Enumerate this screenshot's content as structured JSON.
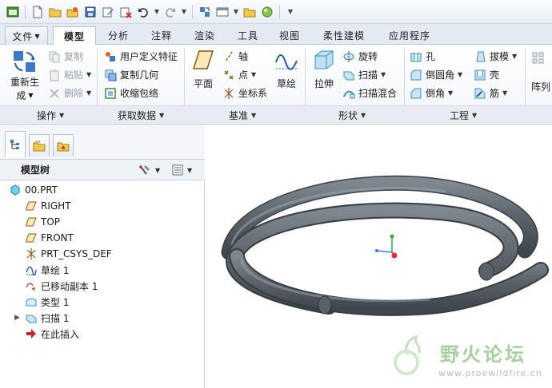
{
  "quick_access": {
    "icons": [
      "window-icon",
      "new-file-icon",
      "open-folder-icon",
      "open-session-icon",
      "save-icon",
      "edit-icon",
      "close-window-icon",
      "undo-icon",
      "redo-icon",
      "regenerate-icon",
      "window-switch-icon",
      "folder-icon",
      "appearance-icon",
      "more-icon"
    ]
  },
  "tabs": [
    {
      "label": "文件",
      "has_dropdown": true
    },
    {
      "label": "模型",
      "active": true
    },
    {
      "label": "分析"
    },
    {
      "label": "注释"
    },
    {
      "label": "渲染"
    },
    {
      "label": "工具"
    },
    {
      "label": "视图"
    },
    {
      "label": "柔性建模"
    },
    {
      "label": "应用程序"
    }
  ],
  "ribbon": {
    "operations": {
      "group_label": "操作",
      "regenerate_line1": "重新生",
      "regenerate_line2": "成",
      "copy": "复制",
      "paste": "粘贴",
      "delete": "删除"
    },
    "get_data": {
      "group_label": "获取数据",
      "user_defined_feature": "用户定义特征",
      "copy_geometry": "复制几何",
      "shrinkwrap": "收缩包络"
    },
    "datum": {
      "group_label": "基准",
      "plane": "平面",
      "axis": "轴",
      "point": "点",
      "csys": "坐标系",
      "sketch": "草绘"
    },
    "shapes": {
      "group_label": "形状",
      "extrude": "拉伸",
      "revolve": "旋转",
      "sweep": "扫描",
      "swept_blend": "扫描混合"
    },
    "engineering": {
      "group_label": "工程",
      "hole": "孔",
      "round": "倒圆角",
      "chamfer": "倒角",
      "draft": "拔模",
      "shell": "壳",
      "rib": "筋"
    },
    "editing": {
      "pattern": "阵列"
    }
  },
  "model_tree": {
    "title": "模型树",
    "items": [
      {
        "label": "00.PRT",
        "icon": "part-icon"
      },
      {
        "label": "RIGHT",
        "icon": "datum-plane-icon"
      },
      {
        "label": "TOP",
        "icon": "datum-plane-icon"
      },
      {
        "label": "FRONT",
        "icon": "datum-plane-icon"
      },
      {
        "label": "PRT_CSYS_DEF",
        "icon": "csys-icon"
      },
      {
        "label": "草绘 1",
        "icon": "sketch-icon"
      },
      {
        "label": "已移动副本 1",
        "icon": "moved-copy-icon"
      },
      {
        "label": "类型 1",
        "icon": "quilt-icon"
      },
      {
        "label": "扫描 1",
        "icon": "sweep-icon",
        "expandable": true
      },
      {
        "label": "在此插入",
        "icon": "insert-here-arrow-icon"
      }
    ]
  },
  "watermark": {
    "title": "野火论坛",
    "url": "www.proewildfire.cn"
  },
  "colors": {
    "ribbon_bg": "#f2f5f9",
    "tab_bar_bg": "#e4eaf2",
    "model_gray": "#5f6870",
    "watermark_green": "#a8cfa0",
    "axis_red": "#e0302f",
    "axis_green": "#2fa84f",
    "axis_blue": "#3a7bd5"
  }
}
